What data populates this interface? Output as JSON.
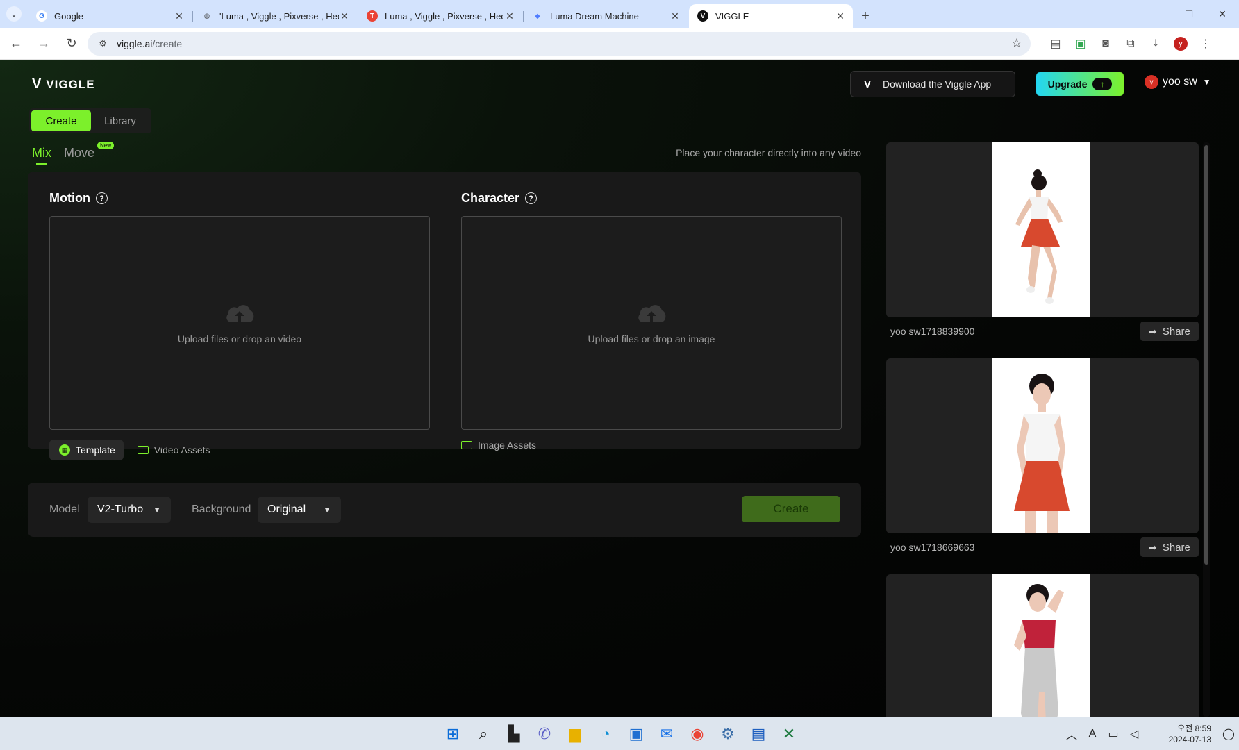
{
  "browser": {
    "tabs": [
      {
        "title": "Google",
        "fav_color": "#4285f4",
        "fav_text": "G",
        "active": false
      },
      {
        "title": "'Luma , Viggle , Pixverse , Hedr",
        "fav_color": "#5f6368",
        "fav_text": "◍",
        "active": false
      },
      {
        "title": "Luma , Viggle , Pixverse , Hedr",
        "fav_color": "#ea4335",
        "fav_text": "T",
        "active": false
      },
      {
        "title": "Luma Dream Machine",
        "fav_color": "#4f7cff",
        "fav_text": "◆",
        "active": false
      },
      {
        "title": "VIGGLE",
        "fav_color": "#111111",
        "fav_text": "V",
        "active": true
      }
    ],
    "new_tab_label": "+",
    "url_host": "viggle.ai",
    "url_path": "/create",
    "profile_initial": "y"
  },
  "app": {
    "logo_text": "VIGGLE",
    "download_label": "Download the Viggle App",
    "upgrade_label": "Upgrade",
    "user_name": "yoo sw",
    "user_initial": "y",
    "segment": {
      "create": "Create",
      "library": "Library"
    },
    "subtabs": {
      "mix": "Mix",
      "move": "Move",
      "new_badge": "New"
    },
    "tagline": "Place your character directly into any video",
    "motion": {
      "title": "Motion",
      "drop_text": "Upload files or drop an video",
      "template_label": "Template",
      "assets_label": "Video Assets"
    },
    "character": {
      "title": "Character",
      "drop_text": "Upload files or drop an image",
      "assets_label": "Image Assets"
    },
    "controls": {
      "model_label": "Model",
      "model_value": "V2-Turbo",
      "background_label": "Background",
      "background_value": "Original",
      "create_label": "Create"
    },
    "feed": [
      {
        "owner": "yoo sw1718839900",
        "share_label": "Share"
      },
      {
        "owner": "yoo sw1718669663",
        "share_label": "Share"
      },
      {
        "owner": "",
        "share_label": ""
      }
    ],
    "colors": {
      "accent": "#7cf02b",
      "panel": "#191919",
      "upgrade_start": "#23d7f2"
    }
  },
  "taskbar": {
    "time": "오전 8:59",
    "date": "2024-07-13",
    "ime": "A"
  }
}
